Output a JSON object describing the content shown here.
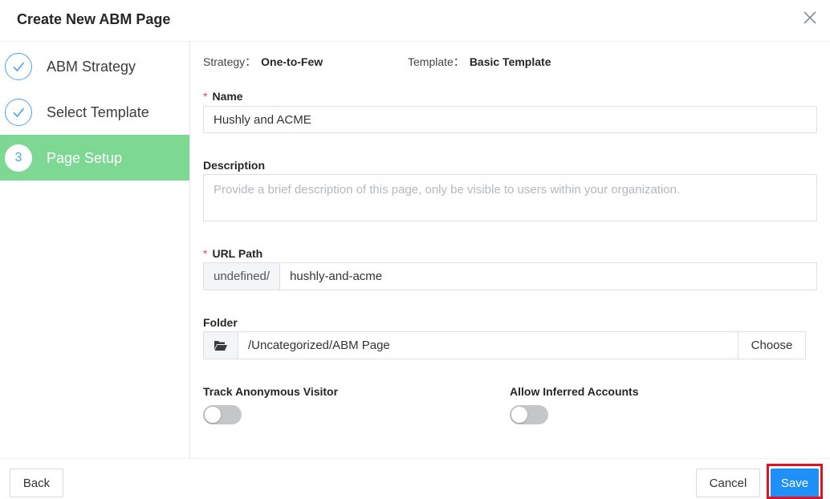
{
  "dialog": {
    "title": "Create New ABM Page",
    "close_icon": "close-icon"
  },
  "steps": [
    {
      "marker": "check-icon",
      "label": "ABM Strategy",
      "state": "done"
    },
    {
      "marker": "check-icon",
      "label": "Select Template",
      "state": "done"
    },
    {
      "marker": "3",
      "label": "Page Setup",
      "state": "active"
    }
  ],
  "info": {
    "strategy_label": "Strategy：",
    "strategy_value": "One-to-Few",
    "template_label": "Template：",
    "template_value": "Basic Template"
  },
  "form": {
    "required_mark": "*",
    "name": {
      "label": "Name",
      "value": "Hushly and ACME"
    },
    "description": {
      "label": "Description",
      "placeholder": "Provide a brief description of this page, only be visible to users within your organization."
    },
    "url_path": {
      "label": "URL Path",
      "prefix": "undefined/",
      "value": "hushly-and-acme"
    },
    "folder": {
      "label": "Folder",
      "icon": "folder-open-icon",
      "path": "/Uncategorized/ABM Page",
      "choose_label": "Choose"
    },
    "track_anonymous": {
      "label": "Track Anonymous Visitor",
      "enabled": false
    },
    "allow_inferred": {
      "label": "Allow Inferred Accounts",
      "enabled": false
    }
  },
  "footer": {
    "back_label": "Back",
    "cancel_label": "Cancel",
    "save_label": "Save"
  },
  "colors": {
    "accent": "#1e90f7",
    "active_step": "#7dd893",
    "step_circle": "#4aa3ef",
    "required": "#e84b4b",
    "highlight": "#e0141e"
  }
}
